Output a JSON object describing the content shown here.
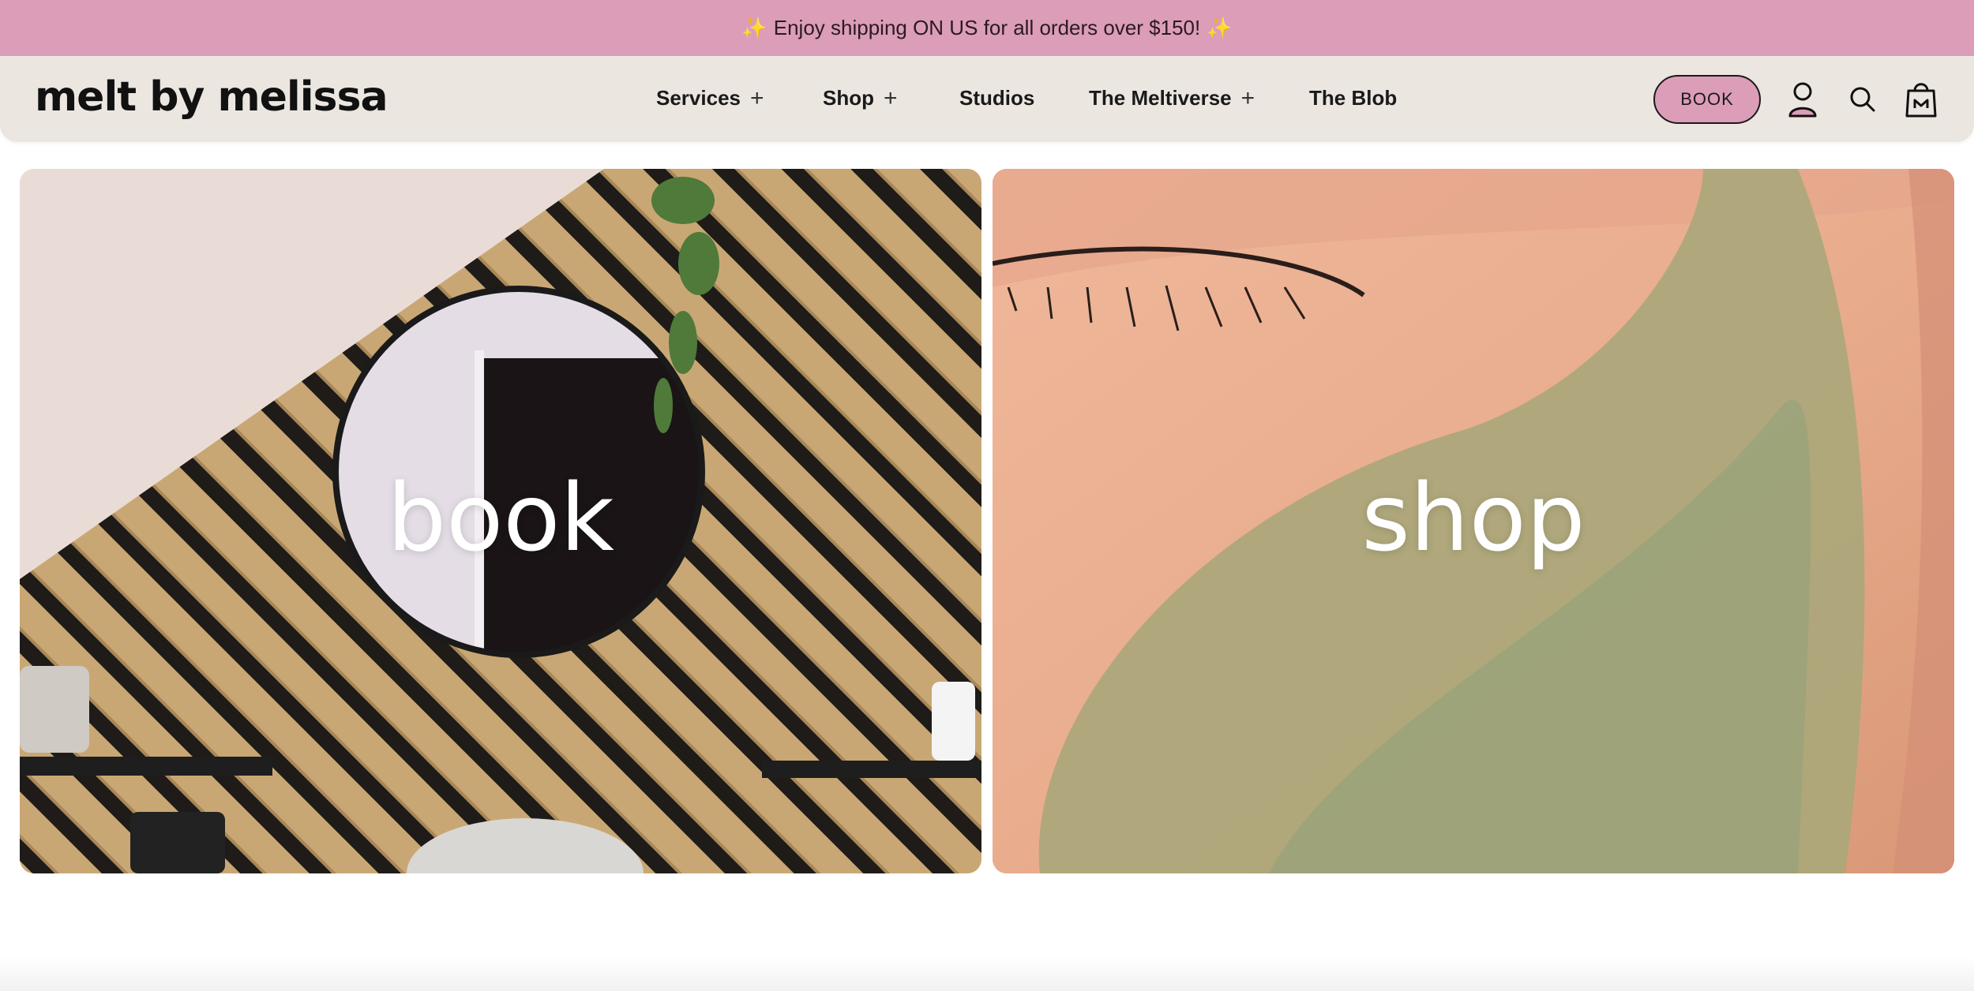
{
  "announcement": {
    "text": "Enjoy shipping ON US for all orders over $150!",
    "sparkle_left": "✨",
    "sparkle_right": "✨"
  },
  "header": {
    "logo": "melt by melissa",
    "nav": [
      {
        "label": "Services",
        "has_submenu": true
      },
      {
        "label": "Shop",
        "has_submenu": true
      },
      {
        "label": "Studios",
        "has_submenu": false
      },
      {
        "label": "The Meltiverse",
        "has_submenu": true
      },
      {
        "label": "The Blob",
        "has_submenu": false
      }
    ],
    "plus_glyph": "+",
    "book_button": "BOOK",
    "icons": [
      "account-icon",
      "search-icon",
      "cart-bag-icon"
    ]
  },
  "hero": {
    "book_label": "book",
    "shop_label": "shop"
  },
  "colors": {
    "announcement_bg": "#dc9db8",
    "header_bg": "#ece6e1",
    "accent_pink": "#dc9db8"
  }
}
